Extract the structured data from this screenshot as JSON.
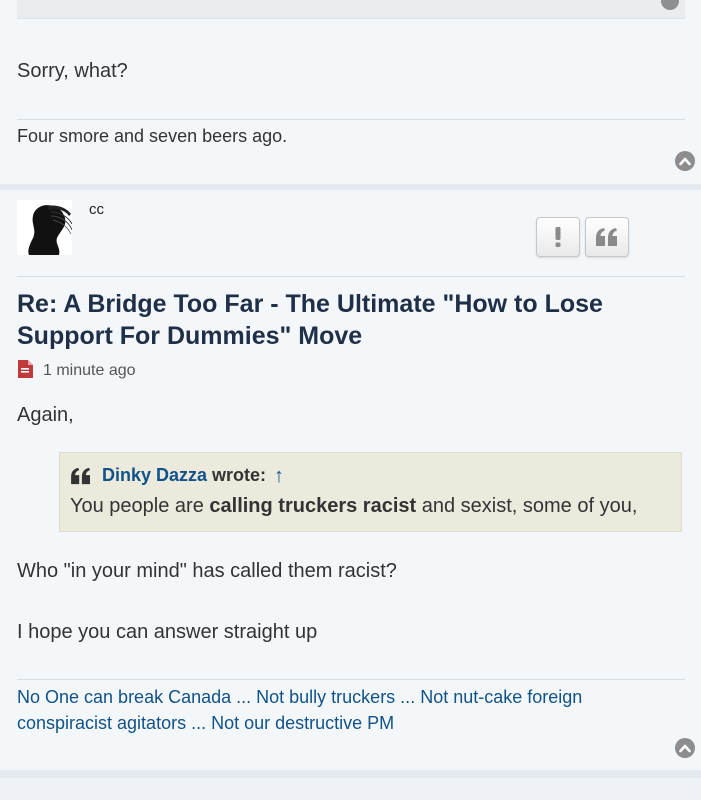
{
  "previous_post": {
    "body": "Sorry, what?",
    "signature": "Four smore and seven beers ago."
  },
  "post": {
    "username": "cc",
    "title": "Re: A Bridge Too Far - The Ultimate \"How to Lose Support For Dummies\" Move",
    "timestamp": "1 minute ago",
    "intro": "Again,",
    "quote": {
      "author": "Dinky Dazza",
      "wrote_label": "wrote:",
      "jump_icon": "↑",
      "text_before": "You people are ",
      "text_bold": "calling truckers racist",
      "text_after": " and sexist, some of you,"
    },
    "paragraph_1": "Who \"in your mind\" has called them racist?",
    "paragraph_2": "I hope you can answer straight up",
    "signature_link": "No One can break Canada ... Not bully truckers ... Not nut-cake foreign conspiracist agitators ... Not our destructive PM"
  },
  "icons": {
    "report": "exclamation-icon",
    "quote": "quote-icon",
    "top": "chevron-up-circle-icon",
    "timestamp": "file-icon"
  },
  "colors": {
    "link": "#105289",
    "title": "#1e2f47",
    "post_bg": "#f4f7fa",
    "page_bg": "#e4e9ef",
    "quote_bg": "#ebeadd",
    "file_icon": "#bf3a3a"
  }
}
